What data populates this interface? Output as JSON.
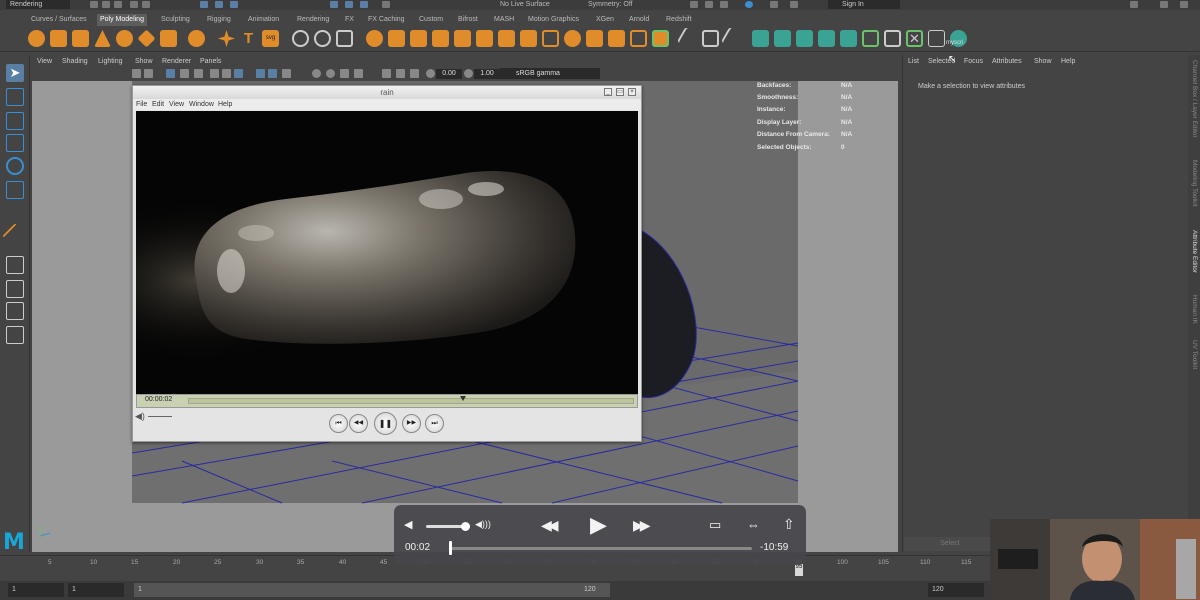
{
  "status_line": {
    "menu_set": "Rendering",
    "live_surface": "No Live Surface",
    "symmetry": "Symmetry: Off",
    "sign_in": "Sign In"
  },
  "shelf_tabs": [
    "Curves / Surfaces",
    "Poly Modeling",
    "Sculpting",
    "Rigging",
    "Animation",
    "Rendering",
    "FX",
    "FX Caching",
    "Custom",
    "Bifrost",
    "MASH",
    "Motion Graphics",
    "XGen",
    "Arnold",
    "Redshift"
  ],
  "shelf_active": "Poly Modeling",
  "shelf_last_icon_label": "myscri",
  "panel_menu": [
    "View",
    "Shading",
    "Lighting",
    "Show",
    "Renderer",
    "Panels"
  ],
  "panel_bar": {
    "exposure": "0.00",
    "gamma_value": "1.00",
    "color_space": "sRGB gamma"
  },
  "hud": [
    {
      "label": "Backfaces:",
      "value": "N/A"
    },
    {
      "label": "Smoothness:",
      "value": "N/A"
    },
    {
      "label": "Instance:",
      "value": "N/A"
    },
    {
      "label": "Display Layer:",
      "value": "N/A"
    },
    {
      "label": "Distance From Camera:",
      "value": "N/A"
    },
    {
      "label": "Selected Objects:",
      "value": "0"
    }
  ],
  "rain_window": {
    "title": "rain",
    "menu": [
      "File",
      "Edit",
      "View",
      "Window",
      "Help"
    ],
    "current_time": "00:00:02",
    "min_glyph": "_",
    "restore_glyph": "▭",
    "close_glyph": "×",
    "vol_glyph": "◀)",
    "controls": {
      "prev_glyph": "⏮",
      "rewind_glyph": "◀◀",
      "pause_glyph": "❚❚",
      "forward_glyph": "▶▶",
      "next_glyph": "⏭"
    }
  },
  "right_panel": {
    "menu": [
      "List",
      "Selected",
      "Focus",
      "Attributes",
      "Show",
      "Help"
    ],
    "message": "Make a selection to view attributes",
    "select_button": "Select",
    "side_tabs": [
      "Channel Box / Layer Editor",
      "Modeling Toolkit",
      "Attribute Editor",
      "Human IK",
      "UV Toolkit"
    ],
    "active_side_tab": "Attribute Editor"
  },
  "timeline": {
    "ticks": [
      "5",
      "10",
      "15",
      "20",
      "25",
      "30",
      "35",
      "40",
      "45",
      "50",
      "55",
      "60",
      "65",
      "70",
      "75",
      "80",
      "85",
      "90",
      "95",
      "100",
      "105",
      "110",
      "115",
      "120"
    ],
    "current_frame": "95"
  },
  "range_bar": {
    "start": "1",
    "playback_start": "1",
    "range_start_label": "1",
    "range_end_label": "120",
    "playback_end": "120"
  },
  "quicktime": {
    "current": "00:02",
    "remaining": "-10:59",
    "volume_glyph": "◀",
    "volume_max_glyph": "◀)))",
    "rewind_glyph": "◀◀",
    "play_glyph": "▶",
    "forward_glyph": "▶▶",
    "airplay_glyph": "▭",
    "pip_glyph": "⇔",
    "share_glyph": "⇧",
    "progress_fraction": 0.003
  },
  "colors": {
    "maya_bg": "#444444",
    "maya_logo": "#1aa5d8",
    "selection_blue": "#5a7fa5",
    "grid_line": "#2a2aa0"
  },
  "logo_text": "M"
}
